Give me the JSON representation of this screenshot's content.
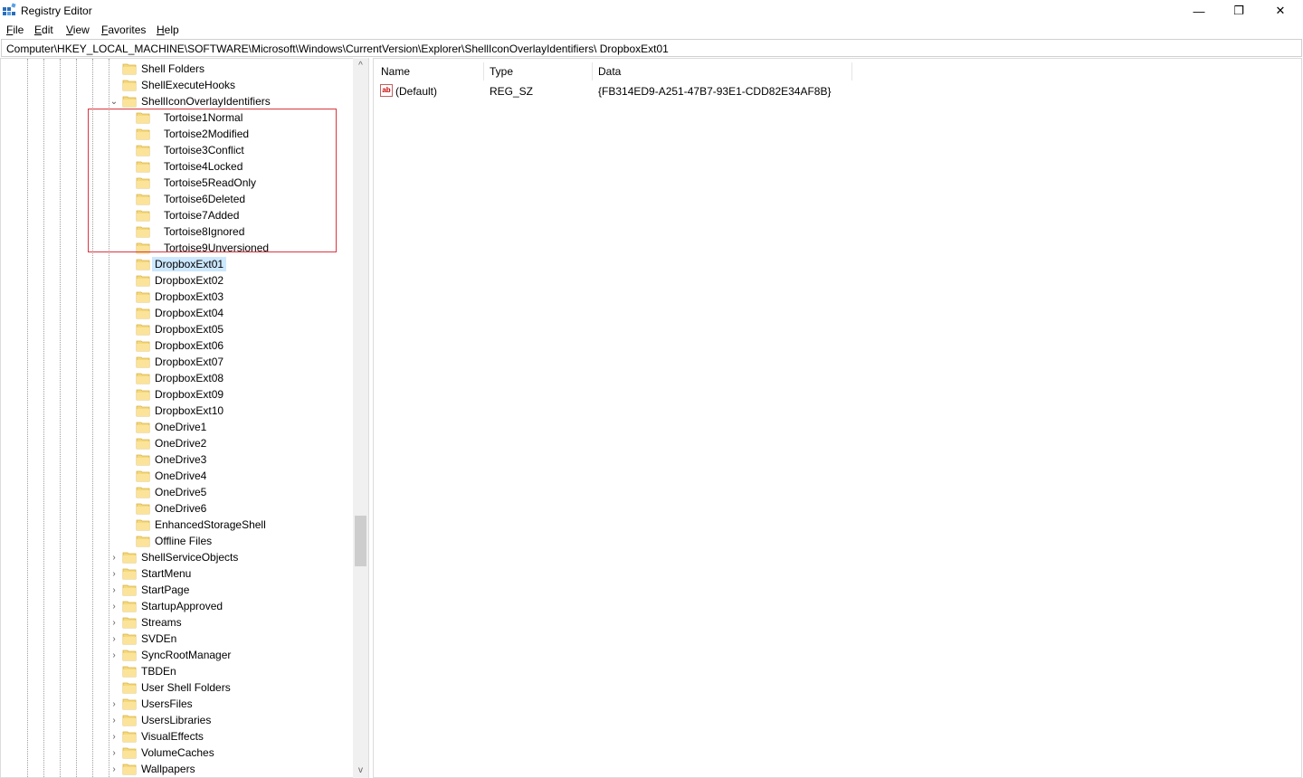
{
  "window": {
    "title": "Registry Editor",
    "minimize": "—",
    "restore": "❐",
    "close": "✕"
  },
  "menu": [
    {
      "key": "F",
      "rest": "ile"
    },
    {
      "key": "E",
      "rest": "dit"
    },
    {
      "key": "V",
      "rest": "iew"
    },
    {
      "key": "F",
      "rest": "avorites",
      "pre": ""
    },
    {
      "key": "H",
      "rest": "elp"
    }
  ],
  "address": "Computer\\HKEY_LOCAL_MACHINE\\SOFTWARE\\Microsoft\\Windows\\CurrentVersion\\Explorer\\ShellIconOverlayIdentifiers\\  DropboxExt01",
  "tree": [
    {
      "label": "Shell Folders",
      "level": 0,
      "exp": ""
    },
    {
      "label": "ShellExecuteHooks",
      "level": 0,
      "exp": ""
    },
    {
      "label": "ShellIconOverlayIdentifiers",
      "level": 0,
      "exp": "v"
    },
    {
      "label": "Tortoise1Normal",
      "level": 2,
      "exp": ""
    },
    {
      "label": "Tortoise2Modified",
      "level": 2,
      "exp": ""
    },
    {
      "label": "Tortoise3Conflict",
      "level": 2,
      "exp": ""
    },
    {
      "label": "Tortoise4Locked",
      "level": 2,
      "exp": ""
    },
    {
      "label": "Tortoise5ReadOnly",
      "level": 2,
      "exp": ""
    },
    {
      "label": "Tortoise6Deleted",
      "level": 2,
      "exp": ""
    },
    {
      "label": "Tortoise7Added",
      "level": 2,
      "exp": ""
    },
    {
      "label": "Tortoise8Ignored",
      "level": 2,
      "exp": ""
    },
    {
      "label": "Tortoise9Unversioned",
      "level": 2,
      "exp": ""
    },
    {
      "label": "DropboxExt01",
      "level": 1,
      "exp": "",
      "selected": true
    },
    {
      "label": "DropboxExt02",
      "level": 1,
      "exp": ""
    },
    {
      "label": "DropboxExt03",
      "level": 1,
      "exp": ""
    },
    {
      "label": "DropboxExt04",
      "level": 1,
      "exp": ""
    },
    {
      "label": "DropboxExt05",
      "level": 1,
      "exp": ""
    },
    {
      "label": "DropboxExt06",
      "level": 1,
      "exp": ""
    },
    {
      "label": "DropboxExt07",
      "level": 1,
      "exp": ""
    },
    {
      "label": "DropboxExt08",
      "level": 1,
      "exp": ""
    },
    {
      "label": "DropboxExt09",
      "level": 1,
      "exp": ""
    },
    {
      "label": "DropboxExt10",
      "level": 1,
      "exp": ""
    },
    {
      "label": "OneDrive1",
      "level": 1,
      "exp": ""
    },
    {
      "label": "OneDrive2",
      "level": 1,
      "exp": ""
    },
    {
      "label": "OneDrive3",
      "level": 1,
      "exp": ""
    },
    {
      "label": "OneDrive4",
      "level": 1,
      "exp": ""
    },
    {
      "label": "OneDrive5",
      "level": 1,
      "exp": ""
    },
    {
      "label": "OneDrive6",
      "level": 1,
      "exp": ""
    },
    {
      "label": "EnhancedStorageShell",
      "level": 1,
      "exp": ""
    },
    {
      "label": "Offline Files",
      "level": 1,
      "exp": ""
    },
    {
      "label": "ShellServiceObjects",
      "level": 0,
      "exp": ">"
    },
    {
      "label": "StartMenu",
      "level": 0,
      "exp": ">"
    },
    {
      "label": "StartPage",
      "level": 0,
      "exp": ">"
    },
    {
      "label": "StartupApproved",
      "level": 0,
      "exp": ">"
    },
    {
      "label": "Streams",
      "level": 0,
      "exp": ">"
    },
    {
      "label": "SVDEn",
      "level": 0,
      "exp": ">"
    },
    {
      "label": "SyncRootManager",
      "level": 0,
      "exp": ">"
    },
    {
      "label": "TBDEn",
      "level": 0,
      "exp": ""
    },
    {
      "label": "User Shell Folders",
      "level": 0,
      "exp": ""
    },
    {
      "label": "UsersFiles",
      "level": 0,
      "exp": ">"
    },
    {
      "label": "UsersLibraries",
      "level": 0,
      "exp": ">"
    },
    {
      "label": "VisualEffects",
      "level": 0,
      "exp": ">"
    },
    {
      "label": "VolumeCaches",
      "level": 0,
      "exp": ">"
    },
    {
      "label": "Wallpapers",
      "level": 0,
      "exp": ">"
    }
  ],
  "columns": {
    "name": "Name",
    "type": "Type",
    "data": "Data"
  },
  "values": [
    {
      "name": "(Default)",
      "type": "REG_SZ",
      "data": "{FB314ED9-A251-47B7-93E1-CDD82E34AF8B}",
      "icon": "string-value-icon"
    }
  ],
  "scroll": {
    "up": "^",
    "down": "v"
  }
}
